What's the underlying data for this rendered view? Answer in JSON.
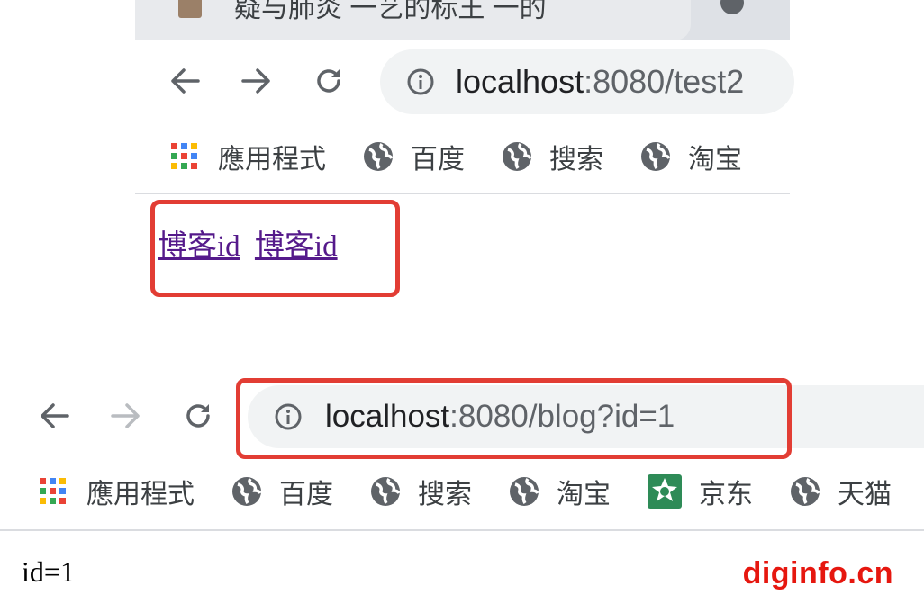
{
  "top_browser": {
    "tab": {
      "title": "疑与肺炎 一艺的标王 一的"
    },
    "address": {
      "host": "localhost",
      "rest": ":8080/test2"
    },
    "bookmarks": [
      {
        "label": "應用程式",
        "icon": "apps-grid-icon"
      },
      {
        "label": "百度",
        "icon": "globe-icon"
      },
      {
        "label": "搜索",
        "icon": "globe-icon"
      },
      {
        "label": "淘宝",
        "icon": "globe-icon"
      }
    ],
    "page": {
      "links": [
        "博客id",
        "博客id"
      ]
    }
  },
  "bottom_browser": {
    "address": {
      "host": "localhost",
      "rest": ":8080/blog?id=1"
    },
    "bookmarks": [
      {
        "label": "應用程式",
        "icon": "apps-grid-icon"
      },
      {
        "label": "百度",
        "icon": "globe-icon"
      },
      {
        "label": "搜索",
        "icon": "globe-icon"
      },
      {
        "label": "淘宝",
        "icon": "globe-icon"
      },
      {
        "label": "京东",
        "icon": "jd-icon"
      },
      {
        "label": "天猫",
        "icon": "globe-icon"
      }
    ],
    "page": {
      "output": "id=1"
    }
  },
  "watermark": "diginfo.cn",
  "colors": {
    "highlight_box": "#e23d34",
    "link": "#551a8b",
    "watermark": "#e6170f",
    "omnibox_bg": "#f1f3f4"
  }
}
